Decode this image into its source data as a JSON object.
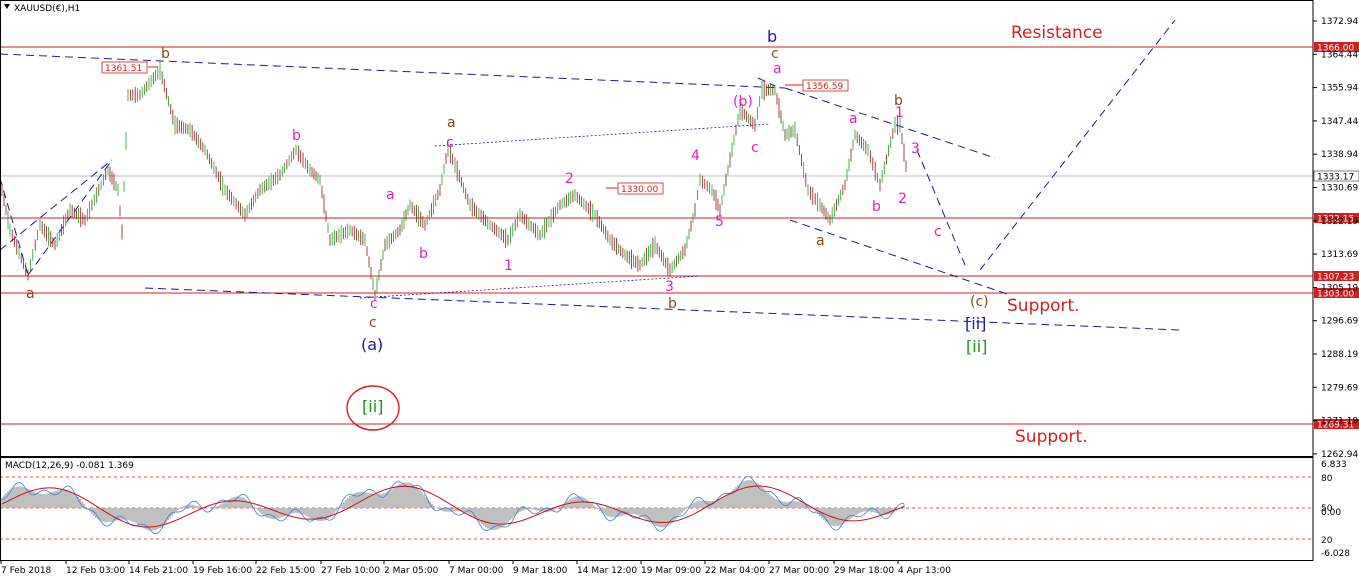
{
  "chart_data": {
    "type": "candlestick",
    "symbol_label": "XAUUSD(€),H1",
    "indicator_label": "MACD(12,26,9) -0.081 1.369",
    "ylim": [
      1262.94,
      1376.0
    ],
    "price_ticks": [
      "1372.94",
      "1364.44",
      "1355.94",
      "1347.44",
      "1338.94",
      "1330.69",
      "1322.19",
      "1313.69",
      "1305.19",
      "1296.69",
      "1288.19",
      "1279.69",
      "1271.19",
      "1262.94"
    ],
    "current_price": "1333.17",
    "x_labels": [
      "7 Feb 2018",
      "12 Feb 03:00",
      "14 Feb 21:00",
      "19 Feb 16:00",
      "22 Feb 15:00",
      "27 Feb 10:00",
      "2 Mar 05:00",
      "7 Mar 00:00",
      "9 Mar 18:00",
      "14 Mar 12:00",
      "19 Mar 09:00",
      "22 Mar 04:00",
      "27 Mar 00:00",
      "29 Mar 18:00",
      "4 Apr 13:00"
    ],
    "levels": [
      {
        "value": 1366.0,
        "label": "1366.00"
      },
      {
        "value": 1322.15,
        "label": "1322.15"
      },
      {
        "value": 1307.23,
        "label": "1307.23"
      },
      {
        "value": 1303.0,
        "label": "1303.00"
      },
      {
        "value": 1269.31,
        "label": "1269.31"
      }
    ],
    "price_tags": [
      "1361.51",
      "1356.59",
      "1330.00"
    ],
    "zone_labels": [
      "Resistance",
      "Support.",
      "Support."
    ],
    "wave_labels": [
      "a",
      "b",
      "c",
      "(a)",
      "[ii]",
      "a",
      "b",
      "c",
      "a",
      "b",
      "c",
      "1",
      "2",
      "3",
      "4",
      "5",
      "(b)",
      "c",
      "a",
      "b",
      "c",
      "a",
      "b",
      "1",
      "2",
      "3",
      "c",
      "(c)",
      "[ii]"
    ],
    "macd": {
      "ylim": [
        -6.028,
        6.833
      ],
      "ticks": [
        "6.833",
        "80",
        "50",
        "0.00",
        "20",
        "-6.028"
      ]
    },
    "colors": {
      "level": "#d11f1f",
      "trend": "#1a1a9c",
      "up": "#1aa31a",
      "down": "#8b1a1a",
      "wave_magenta": "#e020c0",
      "wave_brown": "#8b4513",
      "wave_blue": "#1a1a9c",
      "wave_green": "#1f8f1f",
      "zone": "#d11f1f"
    }
  }
}
